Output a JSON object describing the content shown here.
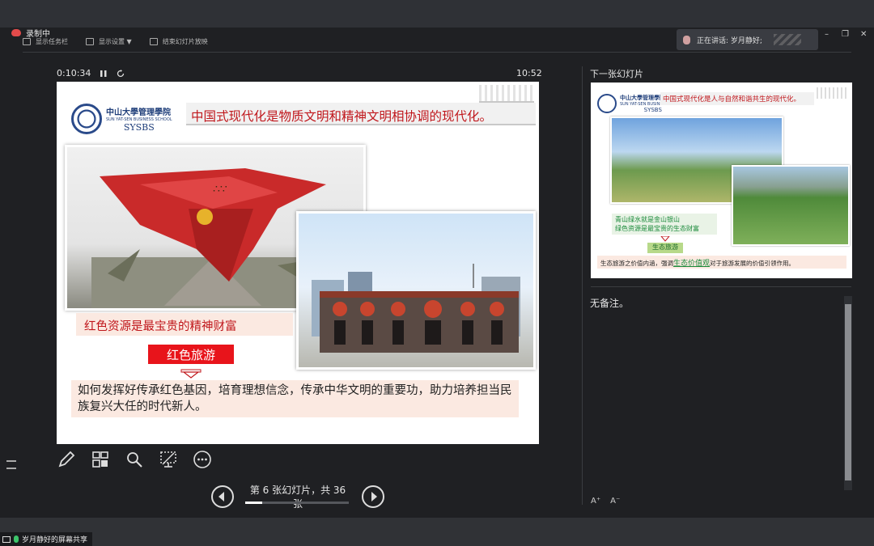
{
  "recording": {
    "label": "录制中"
  },
  "toolbar": {
    "taskbar_label": "显示任务栏",
    "display_settings_label": "显示设置 ▼",
    "end_show_label": "结束幻灯片放映"
  },
  "speaker": {
    "label": "正在讲话: 岁月静好;"
  },
  "window": {
    "minimize": "–",
    "restore": "❐",
    "close": "✕"
  },
  "presenter": {
    "elapsed": "0:10:34",
    "pause_icon": "pause-icon",
    "reset_icon": "reset-icon",
    "clock": "10:52"
  },
  "slide": {
    "logo_cn": "中山大學管理學院",
    "logo_en": "SUN YAT-SEN BUSINESS SCHOOL",
    "logo_abbr": "SYSBS",
    "headline": "中国式现代化是物质文明和精神文明相协调的现代化。",
    "caption": "红色资源是最宝贵的精神财富",
    "red_label": "红色旅游",
    "body": "如何发挥好传承红色基因，培育理想信念，传承中华文明的重要功，助力培养担当民族复兴大任的时代新人。"
  },
  "navigation": {
    "page_info": "第 6 张幻灯片，共 36 张",
    "current": 6,
    "total": 36
  },
  "next_slide": {
    "label": "下一张幻灯片",
    "logo_cn": "中山大學管理學院",
    "logo_en": "SUN YAT-SEN BUSINESS SCHOOL",
    "logo_abbr": "SYSBS",
    "headline": "中国式现代化是人与自然和谐共生的现代化。",
    "green_line1": "青山绿水就是金山银山",
    "green_line2": "绿色资源是最宝贵的生态财富",
    "badge": "生态旅游",
    "bottom_prefix": "生态旅游之价值内涵，强调",
    "bottom_highlight": "生态价值观",
    "bottom_suffix": "对于旅游发展的价值引领作用。"
  },
  "notes": {
    "text": "无备注。"
  },
  "font_controls": {
    "increase": "A⁺",
    "decrease": "A⁻"
  },
  "share_bar": {
    "label": "岁月静好的屏幕共享"
  }
}
